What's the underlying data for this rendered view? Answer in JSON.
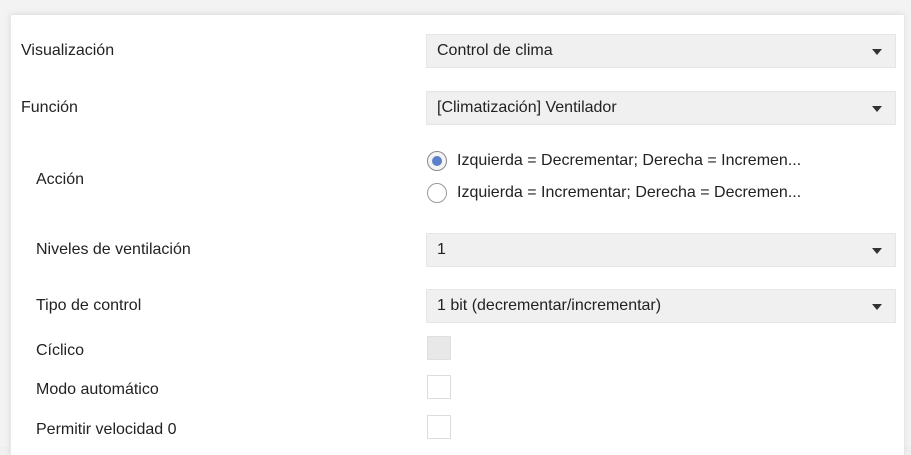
{
  "visualizacion": {
    "label": "Visualización",
    "value": "Control de clima"
  },
  "funcion": {
    "label": "Función",
    "value": "[Climatización] Ventilador"
  },
  "accion": {
    "label": "Acción",
    "options": [
      {
        "text": "Izquierda = Decrementar; Derecha = Incremen...",
        "selected": true
      },
      {
        "text": "Izquierda = Incrementar; Derecha = Decremen...",
        "selected": false
      }
    ]
  },
  "niveles": {
    "label": "Niveles de ventilación",
    "value": "1"
  },
  "tipo_control": {
    "label": "Tipo de control",
    "value": "1 bit (decrementar/incrementar)"
  },
  "ciclico": {
    "label": "Cíclico",
    "checked": false,
    "enabled": false
  },
  "modo_automatico": {
    "label": "Modo automático",
    "checked": false,
    "enabled": true
  },
  "permitir_velocidad": {
    "label": "Permitir velocidad 0",
    "checked": false,
    "enabled": true
  },
  "colors": {
    "radio_accent": "#5b7fc9",
    "dropdown_bg": "#f0f0f0",
    "text": "#222222"
  }
}
